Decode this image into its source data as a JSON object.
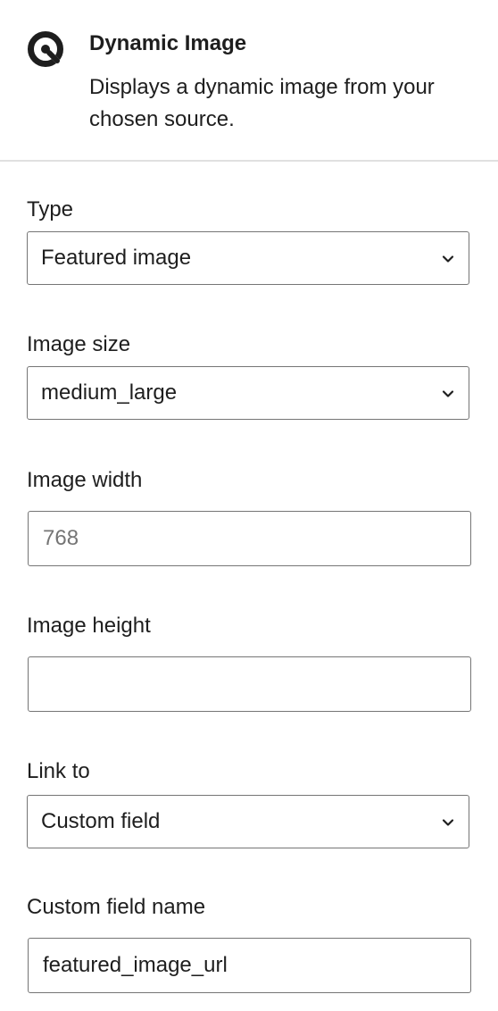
{
  "block": {
    "title": "Dynamic Image",
    "description": "Displays a dynamic image from your chosen source.",
    "icon": "dynamic-image-icon"
  },
  "fields": {
    "type": {
      "label": "Type",
      "value": "Featured image"
    },
    "image_size": {
      "label": "Image size",
      "value": "medium_large"
    },
    "image_width": {
      "label": "Image width",
      "value": "",
      "placeholder": "768"
    },
    "image_height": {
      "label": "Image height",
      "value": "",
      "placeholder": ""
    },
    "link_to": {
      "label": "Link to",
      "value": "Custom field"
    },
    "custom_field_name": {
      "label": "Custom field name",
      "value": "featured_image_url"
    }
  }
}
